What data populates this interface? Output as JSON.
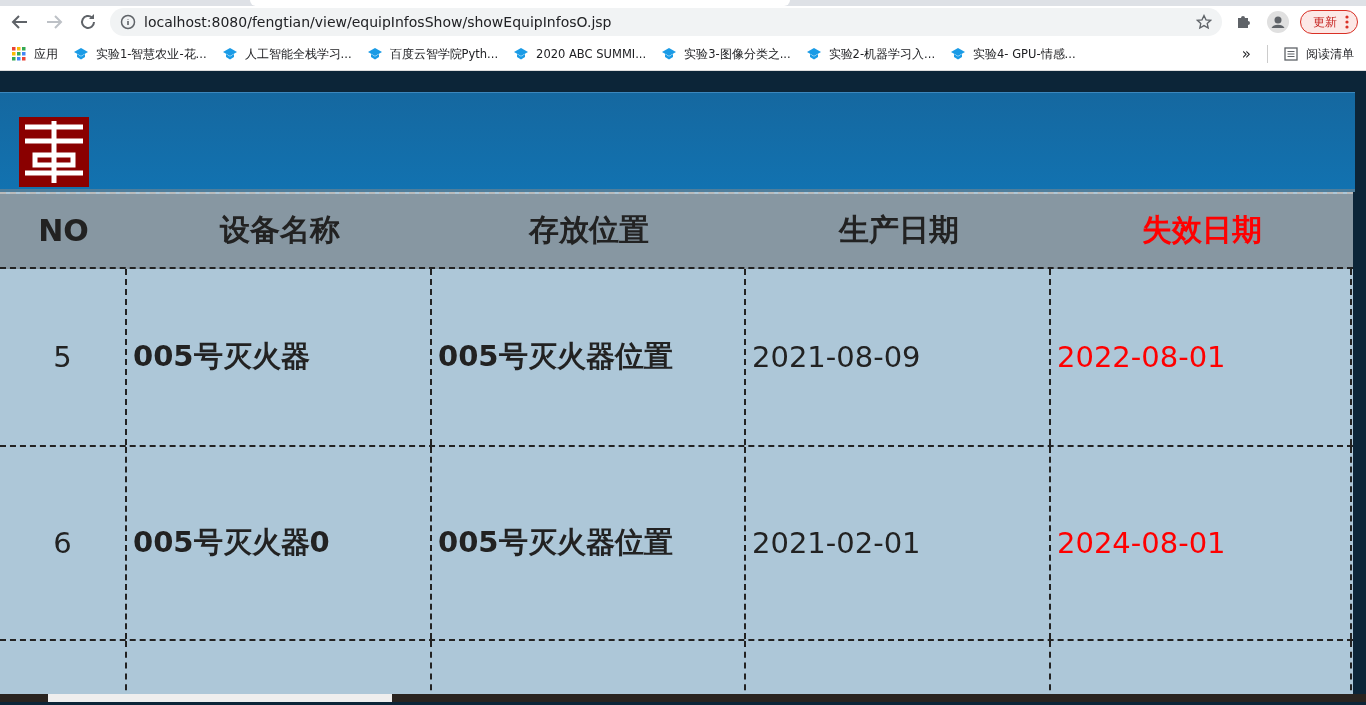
{
  "browser": {
    "url": "localhost:8080/fengtian/view/equipInfosShow/showEquipInfosO.jsp",
    "update_button": "更新",
    "apps_label": "应用",
    "bookmarks": [
      "实验1-智慧农业-花...",
      "人工智能全栈学习...",
      "百度云智学院Pyth...",
      "2020 ABC SUMMI...",
      "实验3-图像分类之...",
      "实验2-机器学习入...",
      "实验4- GPU-情感..."
    ],
    "overflow": "»",
    "reading_list": "阅读清单"
  },
  "table": {
    "columns": [
      {
        "label": "NO",
        "highlight": false
      },
      {
        "label": "设备名称",
        "highlight": false
      },
      {
        "label": "存放位置",
        "highlight": false
      },
      {
        "label": "生产日期",
        "highlight": false
      },
      {
        "label": "失效日期",
        "highlight": true
      }
    ],
    "rows": [
      [
        "5",
        "005号灭火器",
        "005号灭火器位置",
        "2021-08-09",
        "2022-08-01"
      ],
      [
        "6",
        "005号灭火器0",
        "005号灭火器位置",
        "2021-02-01",
        "2024-08-01"
      ]
    ]
  }
}
